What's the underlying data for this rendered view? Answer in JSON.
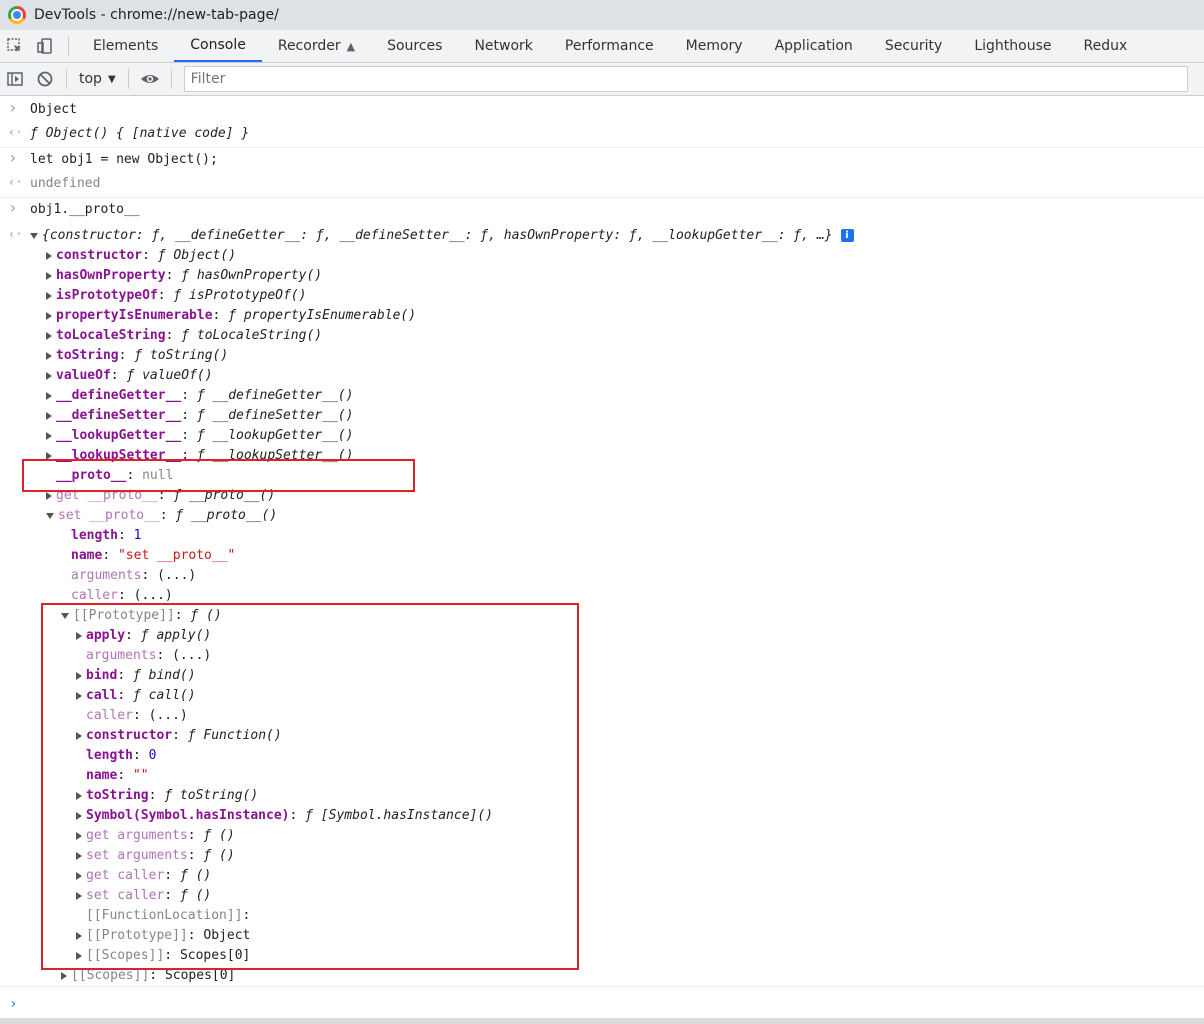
{
  "window": {
    "title": "DevTools - chrome://new-tab-page/"
  },
  "tabs": [
    "Elements",
    "Console",
    "Recorder",
    "Sources",
    "Network",
    "Performance",
    "Memory",
    "Application",
    "Security",
    "Lighthouse",
    "Redux"
  ],
  "active_tab": "Console",
  "toolbar": {
    "context": "top",
    "filter_placeholder": "Filter"
  },
  "console": {
    "entries": [
      {
        "kind": "input",
        "text": "Object"
      },
      {
        "kind": "output",
        "text": "ƒ Object() { [native code] }"
      },
      {
        "kind": "input",
        "text": "let obj1 = new Object();"
      },
      {
        "kind": "output",
        "text": "undefined"
      },
      {
        "kind": "input",
        "text": "obj1.__proto__"
      },
      {
        "kind": "output",
        "text": "{constructor: ƒ, __defineGetter__: ƒ, __defineSetter__: ƒ, hasOwnProperty: ƒ, __lookupGetter__: ƒ, …}"
      }
    ],
    "tree": [
      {
        "k": "constructor",
        "v": "ƒ Object()",
        "indent": 0,
        "exp": "r",
        "style": "key"
      },
      {
        "k": "hasOwnProperty",
        "v": "ƒ hasOwnProperty()",
        "indent": 0,
        "exp": "r",
        "style": "key"
      },
      {
        "k": "isPrototypeOf",
        "v": "ƒ isPrototypeOf()",
        "indent": 0,
        "exp": "r",
        "style": "key"
      },
      {
        "k": "propertyIsEnumerable",
        "v": "ƒ propertyIsEnumerable()",
        "indent": 0,
        "exp": "r",
        "style": "key"
      },
      {
        "k": "toLocaleString",
        "v": "ƒ toLocaleString()",
        "indent": 0,
        "exp": "r",
        "style": "key"
      },
      {
        "k": "toString",
        "v": "ƒ toString()",
        "indent": 0,
        "exp": "r",
        "style": "key"
      },
      {
        "k": "valueOf",
        "v": "ƒ valueOf()",
        "indent": 0,
        "exp": "r",
        "style": "key"
      },
      {
        "k": "__defineGetter__",
        "v": "ƒ __defineGetter__()",
        "indent": 0,
        "exp": "r",
        "style": "key"
      },
      {
        "k": "__defineSetter__",
        "v": "ƒ __defineSetter__()",
        "indent": 0,
        "exp": "r",
        "style": "key"
      },
      {
        "k": "__lookupGetter__",
        "v": "ƒ __lookupGetter__()",
        "indent": 0,
        "exp": "r",
        "style": "key"
      },
      {
        "k": "__lookupSetter__",
        "v": "ƒ __lookupSetter__()",
        "indent": 0,
        "exp": "r",
        "style": "key"
      },
      {
        "k": "__proto__",
        "v": "null",
        "indent": 0,
        "exp": "",
        "style": "key",
        "vstyle": "grey"
      },
      {
        "k": "get __proto__",
        "v": "ƒ __proto__()",
        "indent": 0,
        "exp": "r",
        "style": "key-dim"
      },
      {
        "k": "set __proto__",
        "v": "ƒ __proto__()",
        "indent": 0,
        "exp": "d",
        "style": "key-dim"
      },
      {
        "k": "length",
        "v": "1",
        "indent": 1,
        "exp": "",
        "style": "key",
        "vstyle": "num"
      },
      {
        "k": "name",
        "v": "\"set __proto__\"",
        "indent": 1,
        "exp": "",
        "style": "key",
        "vstyle": "str"
      },
      {
        "k": "arguments",
        "v": "(...)",
        "indent": 1,
        "exp": "",
        "style": "key-dim",
        "vstyle": "plain"
      },
      {
        "k": "caller",
        "v": "(...)",
        "indent": 1,
        "exp": "",
        "style": "key-dim",
        "vstyle": "plain"
      },
      {
        "k": "[[Prototype]]",
        "v": "ƒ ()",
        "indent": 1,
        "exp": "d",
        "style": "grey"
      },
      {
        "k": "apply",
        "v": "ƒ apply()",
        "indent": 2,
        "exp": "r",
        "style": "key"
      },
      {
        "k": "arguments",
        "v": "(...)",
        "indent": 2,
        "exp": "",
        "style": "key-dim",
        "vstyle": "plain"
      },
      {
        "k": "bind",
        "v": "ƒ bind()",
        "indent": 2,
        "exp": "r",
        "style": "key"
      },
      {
        "k": "call",
        "v": "ƒ call()",
        "indent": 2,
        "exp": "r",
        "style": "key"
      },
      {
        "k": "caller",
        "v": "(...)",
        "indent": 2,
        "exp": "",
        "style": "key-dim",
        "vstyle": "plain"
      },
      {
        "k": "constructor",
        "v": "ƒ Function()",
        "indent": 2,
        "exp": "r",
        "style": "key"
      },
      {
        "k": "length",
        "v": "0",
        "indent": 2,
        "exp": "",
        "style": "key",
        "vstyle": "num"
      },
      {
        "k": "name",
        "v": "\"\"",
        "indent": 2,
        "exp": "",
        "style": "key",
        "vstyle": "str"
      },
      {
        "k": "toString",
        "v": "ƒ toString()",
        "indent": 2,
        "exp": "r",
        "style": "key"
      },
      {
        "k": "Symbol(Symbol.hasInstance)",
        "v": "ƒ [Symbol.hasInstance]()",
        "indent": 2,
        "exp": "r",
        "style": "key"
      },
      {
        "k": "get arguments",
        "v": "ƒ ()",
        "indent": 2,
        "exp": "r",
        "style": "key-dim"
      },
      {
        "k": "set arguments",
        "v": "ƒ ()",
        "indent": 2,
        "exp": "r",
        "style": "key-dim"
      },
      {
        "k": "get caller",
        "v": "ƒ ()",
        "indent": 2,
        "exp": "r",
        "style": "key-dim"
      },
      {
        "k": "set caller",
        "v": "ƒ ()",
        "indent": 2,
        "exp": "r",
        "style": "key-dim"
      },
      {
        "k": "[[FunctionLocation]]",
        "v": "",
        "indent": 2,
        "exp": "",
        "style": "grey"
      },
      {
        "k": "[[Prototype]]",
        "v": "Object",
        "indent": 2,
        "exp": "r",
        "style": "grey",
        "vstyle": "plain"
      },
      {
        "k": "[[Scopes]]",
        "v": "Scopes[0]",
        "indent": 2,
        "exp": "r",
        "style": "grey",
        "vstyle": "plain"
      },
      {
        "k": "[[Scopes]]",
        "v": "Scopes[0]",
        "indent": 1,
        "exp": "r",
        "style": "grey",
        "vstyle": "plain"
      }
    ]
  },
  "colors": {
    "highlight_box": "#e0212a",
    "accent": "#1a73e8"
  }
}
